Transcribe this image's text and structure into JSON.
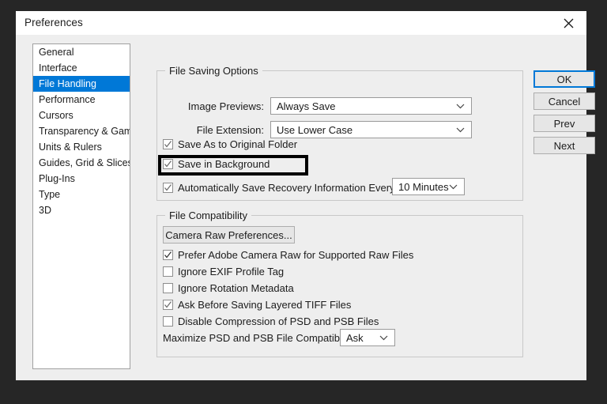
{
  "window": {
    "title": "Preferences",
    "close_icon": "close-icon"
  },
  "sidebar": {
    "items": [
      {
        "label": "General",
        "selected": false
      },
      {
        "label": "Interface",
        "selected": false
      },
      {
        "label": "File Handling",
        "selected": true
      },
      {
        "label": "Performance",
        "selected": false
      },
      {
        "label": "Cursors",
        "selected": false
      },
      {
        "label": "Transparency & Gamut",
        "selected": false
      },
      {
        "label": "Units & Rulers",
        "selected": false
      },
      {
        "label": "Guides, Grid & Slices",
        "selected": false
      },
      {
        "label": "Plug-Ins",
        "selected": false
      },
      {
        "label": "Type",
        "selected": false
      },
      {
        "label": "3D",
        "selected": false
      }
    ]
  },
  "file_saving": {
    "legend": "File Saving Options",
    "image_previews": {
      "label": "Image Previews:",
      "value": "Always Save"
    },
    "file_extension": {
      "label": "File Extension:",
      "value": "Use Lower Case"
    },
    "save_as_original": {
      "label": "Save As to Original Folder",
      "checked": true
    },
    "save_in_background": {
      "label": "Save in Background",
      "checked": true,
      "highlighted": true
    },
    "auto_save_recovery": {
      "label": "Automatically Save Recovery Information Every:",
      "checked": true,
      "value": "10 Minutes"
    }
  },
  "file_compatibility": {
    "legend": "File Compatibility",
    "camera_raw_button": "Camera Raw Preferences...",
    "checkboxes": [
      {
        "label": "Prefer Adobe Camera Raw for Supported Raw Files",
        "checked": true
      },
      {
        "label": "Ignore EXIF Profile Tag",
        "checked": false
      },
      {
        "label": "Ignore Rotation Metadata",
        "checked": false
      },
      {
        "label": "Ask Before Saving Layered TIFF Files",
        "checked": true
      },
      {
        "label": "Disable Compression of PSD and PSB Files",
        "checked": false
      }
    ],
    "maximize": {
      "label": "Maximize PSD and PSB File Compatibility:",
      "value": "Ask"
    }
  },
  "buttons": {
    "ok": "OK",
    "cancel": "Cancel",
    "prev": "Prev",
    "next": "Next"
  },
  "colors": {
    "accent": "#0078d7",
    "dialog_bg": "#eeeeee",
    "desktop_bg": "#262626",
    "highlight_outline": "#000000"
  }
}
